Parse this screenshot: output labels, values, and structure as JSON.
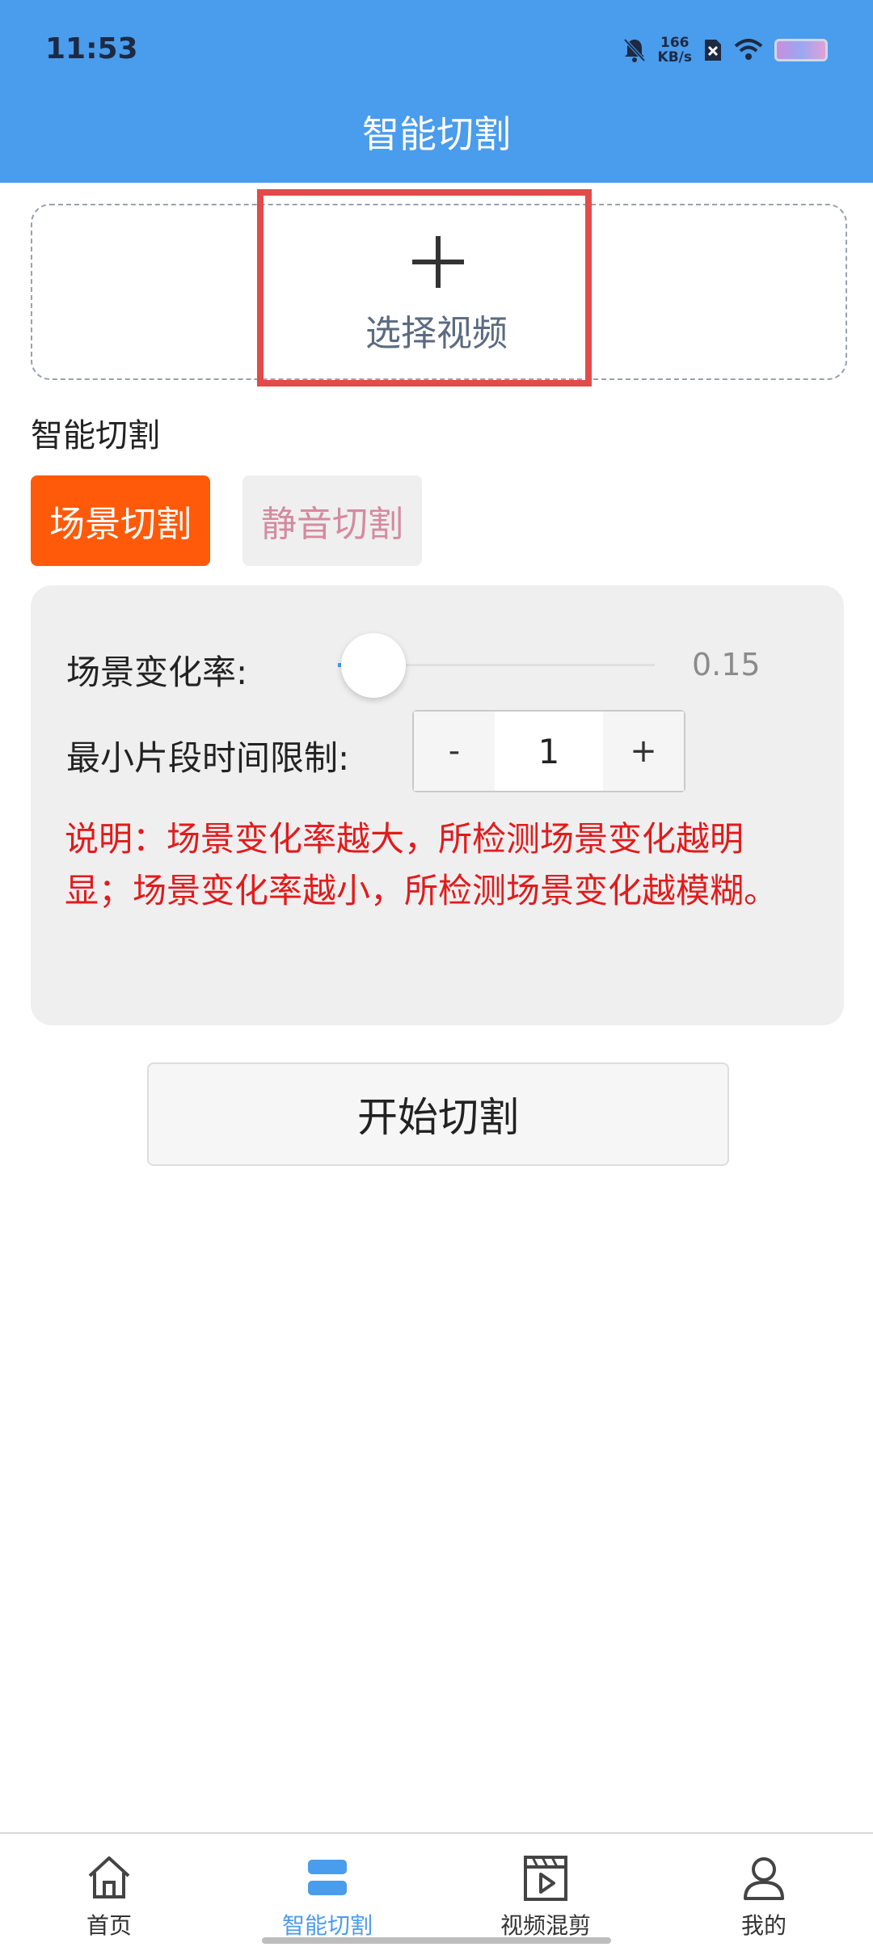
{
  "status_bar": {
    "time": "11:53",
    "speed_value": "166",
    "speed_unit": "KB/s",
    "icons": [
      "mute-bell-icon",
      "sim-icon",
      "wifi-icon",
      "battery-icon"
    ]
  },
  "header": {
    "title": "智能切割"
  },
  "upload": {
    "label": "选择视频",
    "icon": "plus-icon"
  },
  "section": {
    "title": "智能切割"
  },
  "tabs": [
    {
      "label": "场景切割",
      "active": true
    },
    {
      "label": "静音切割",
      "active": false
    }
  ],
  "settings": {
    "scene_rate_label": "场景变化率:",
    "scene_rate_value": "0.15",
    "min_segment_label": "最小片段时间限制:",
    "stepper": {
      "minus": "-",
      "value": "1",
      "plus": "+"
    },
    "note": "说明：场景变化率越大，所检测场景变化越明显；场景变化率越小，所检测场景变化越模糊。"
  },
  "actions": {
    "start_label": "开始切割"
  },
  "bottom_nav": [
    {
      "label": "首页",
      "icon": "home-icon",
      "active": false
    },
    {
      "label": "智能切割",
      "icon": "split-icon",
      "active": true
    },
    {
      "label": "视频混剪",
      "icon": "clapperboard-icon",
      "active": false
    },
    {
      "label": "我的",
      "icon": "user-icon",
      "active": false
    }
  ],
  "colors": {
    "primary": "#4a9cec",
    "active_tab": "#ff5a0a",
    "note_text": "#e21b1b",
    "highlight_border": "#e34a4a"
  }
}
